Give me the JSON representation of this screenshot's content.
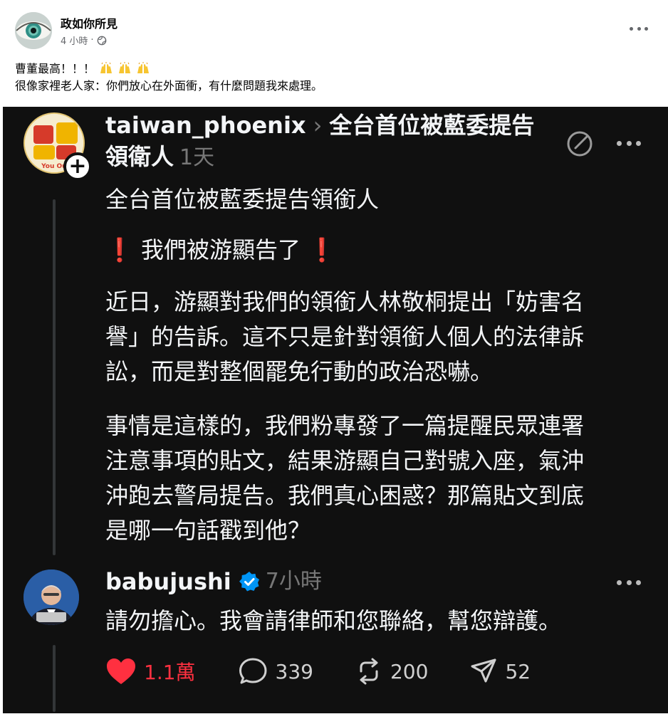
{
  "post": {
    "author": "政如你所見",
    "time": "4 小時",
    "dot": "·",
    "privacy_icon": "globe-icon",
    "text_line1": "曹董最高！！！",
    "text_line2": "很像家裡老人家：你們放心在外面衝，有什麼問題我來處理。"
  },
  "threads": {
    "original": {
      "username": "taiwan_phoenix",
      "separator": "›",
      "topic": "全台首位被藍委提告領衛人",
      "time": "1天",
      "avatar_text": "去游除稿 You Out",
      "title": "全台首位被藍委提告領銜人",
      "alert_text": "我們被游顯告了",
      "para1_line1": "近日，游顯對我們的領銜人林敬桐提出「妨害名",
      "para1_line2": "譽」的告訴。這不只是針對領銜人個人的法律訴",
      "para1_line3": "訟，而是對整個罷免行動的政治恐嚇。",
      "para2_line1": "事情是這樣的，我們粉專發了一篇提醒民眾連署",
      "para2_line2": "注意事項的貼文，結果游顯自己對號入座，氣沖",
      "para2_line3": "沖跑去警局提告。我們真心困惑？那篇貼文到底",
      "para2_line4": "是哪一句話戳到他？"
    },
    "reply": {
      "username": "babujushi",
      "time": "7小時",
      "text": "請勿擔心。我會請律師和您聯絡，幫您辯護。"
    },
    "actions": {
      "likes": "1.1萬",
      "comments": "339",
      "reposts": "200",
      "shares": "52"
    }
  },
  "colors": {
    "threads_bg": "#101010",
    "like_red": "#ff3040",
    "alert_red": "#e0212e",
    "verified_blue": "#0095f6",
    "meta_gray": "#65676b"
  }
}
